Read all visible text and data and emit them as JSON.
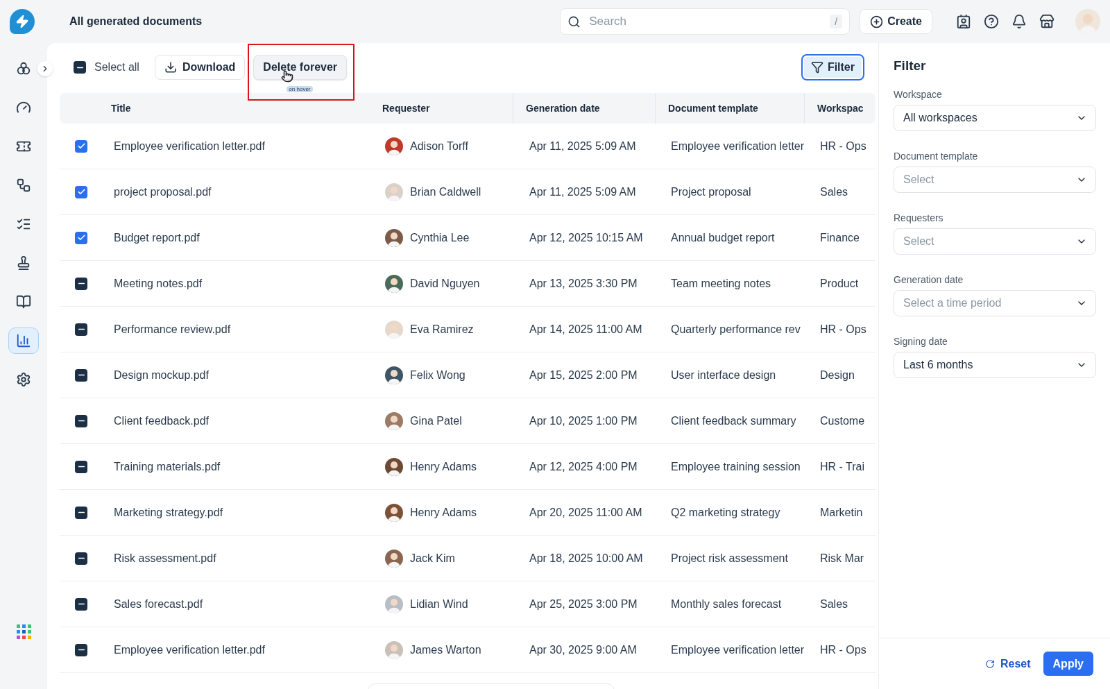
{
  "header": {
    "title": "All generated documents",
    "search": {
      "placeholder": "Search",
      "shortcut": "/"
    },
    "create_button": "Create"
  },
  "sidebar": {
    "items": [
      {
        "selected": false
      },
      {
        "selected": false
      },
      {
        "selected": false
      },
      {
        "selected": false
      },
      {
        "selected": false
      },
      {
        "selected": false
      },
      {
        "selected": false
      },
      {
        "selected": true
      },
      {
        "selected": false
      }
    ]
  },
  "toolbar": {
    "select_all": {
      "label": "Select all",
      "checked": false,
      "indeterminate": true
    },
    "download": "Download",
    "delete": {
      "label": "Delete forever",
      "hovered": true,
      "note": "on hover"
    },
    "filter": {
      "label": "Filter",
      "active": true
    }
  },
  "table": {
    "columns": [
      "Title",
      "Requester",
      "Generation date",
      "Document template",
      "Workspac"
    ],
    "rows": [
      {
        "checked": true,
        "indeterminate": false,
        "title": "Employee verification letter.pdf",
        "requester": "Adison Torff",
        "date": "Apr 11, 2025 5:09 AM",
        "template": "Employee verification letter",
        "workspace": "HR - Ops"
      },
      {
        "checked": true,
        "indeterminate": false,
        "title": "project proposal.pdf",
        "requester": "Brian Caldwell",
        "date": "Apr 11, 2025 5:09 AM",
        "template": "Project proposal",
        "workspace": "Sales"
      },
      {
        "checked": true,
        "indeterminate": false,
        "title": "Budget report.pdf",
        "requester": "Cynthia Lee",
        "date": "Apr 12, 2025 10:15 AM",
        "template": "Annual budget report",
        "workspace": "Finance"
      },
      {
        "checked": false,
        "indeterminate": true,
        "title": "Meeting notes.pdf",
        "requester": "David Nguyen",
        "date": "Apr 13, 2025 3:30 PM",
        "template": "Team meeting notes",
        "workspace": "Product"
      },
      {
        "checked": false,
        "indeterminate": true,
        "title": "Performance review.pdf",
        "requester": "Eva Ramirez",
        "date": "Apr 14, 2025 11:00 AM",
        "template": "Quarterly performance rev",
        "workspace": "HR - Ops"
      },
      {
        "checked": false,
        "indeterminate": true,
        "title": "Design mockup.pdf",
        "requester": "Felix Wong",
        "date": "Apr 15, 2025 2:00 PM",
        "template": "User interface design",
        "workspace": "Design"
      },
      {
        "checked": false,
        "indeterminate": true,
        "title": "Client feedback.pdf",
        "requester": "Gina Patel",
        "date": "Apr 10, 2025 1:00 PM",
        "template": "Client feedback summary",
        "workspace": "Custome"
      },
      {
        "checked": false,
        "indeterminate": true,
        "title": "Training materials.pdf",
        "requester": "Henry Adams",
        "date": "Apr 12, 2025 4:00 PM",
        "template": "Employee training session",
        "workspace": "HR - Trai"
      },
      {
        "checked": false,
        "indeterminate": true,
        "title": "Marketing strategy.pdf",
        "requester": "Henry Adams",
        "date": "Apr 20, 2025 11:00 AM",
        "template": "Q2 marketing strategy",
        "workspace": "Marketin"
      },
      {
        "checked": false,
        "indeterminate": true,
        "title": "Risk assessment.pdf",
        "requester": "Jack Kim",
        "date": "Apr 18, 2025 10:00 AM",
        "template": "Project risk assessment",
        "workspace": "Risk Mar"
      },
      {
        "checked": false,
        "indeterminate": true,
        "title": "Sales forecast.pdf",
        "requester": "Lidian Wind",
        "date": "Apr 25, 2025 3:00 PM",
        "template": "Monthly sales forecast",
        "workspace": "Sales"
      },
      {
        "checked": false,
        "indeterminate": true,
        "title": "Employee verification letter.pdf",
        "requester": "James Warton",
        "date": "Apr 30, 2025 9:00 AM",
        "template": "Employee verification letter",
        "workspace": "HR - Ops"
      }
    ]
  },
  "filter_panel": {
    "title": "Filter",
    "fields": [
      {
        "label": "Workspace",
        "value": "All workspaces"
      },
      {
        "label": "Document template",
        "placeholder": "Select"
      },
      {
        "label": "Requesters",
        "placeholder": "Select"
      },
      {
        "label": "Generation date",
        "placeholder": "Select a time period"
      },
      {
        "label": "Signing date",
        "value": "Last 6 months"
      }
    ],
    "reset": "Reset",
    "apply": "Apply"
  }
}
